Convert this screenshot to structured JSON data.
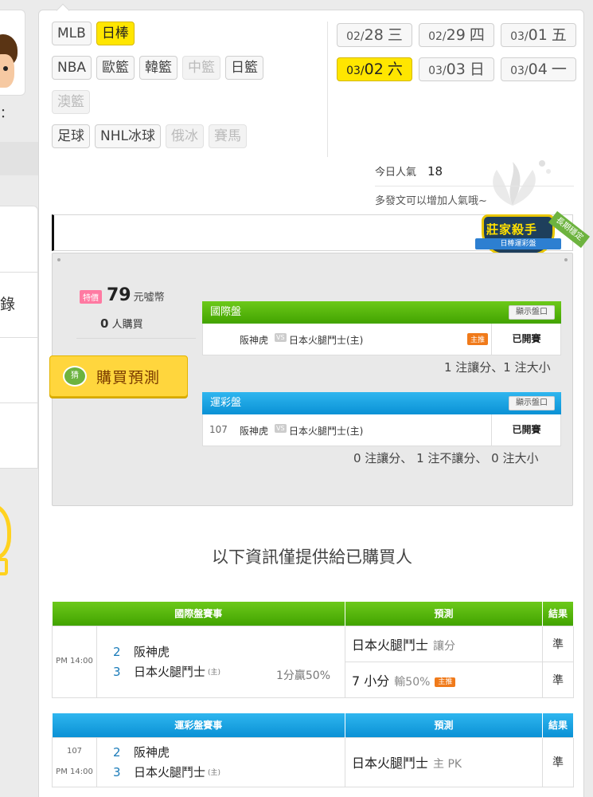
{
  "sidebar": {
    "partial_char": "：",
    "partial_label": "錄"
  },
  "leagues": {
    "rows": [
      [
        {
          "label": "MLB",
          "state": "normal"
        },
        {
          "label": "日棒",
          "state": "active"
        }
      ],
      [
        {
          "label": "NBA",
          "state": "normal"
        },
        {
          "label": "歐籃",
          "state": "normal"
        },
        {
          "label": "韓籃",
          "state": "normal"
        },
        {
          "label": "中籃",
          "state": "disabled"
        },
        {
          "label": "日籃",
          "state": "normal"
        }
      ],
      [
        {
          "label": "澳籃",
          "state": "disabled"
        }
      ],
      [
        {
          "label": "足球",
          "state": "normal"
        },
        {
          "label": "NHL冰球",
          "state": "normal"
        },
        {
          "label": "俄冰",
          "state": "disabled"
        },
        {
          "label": "賽馬",
          "state": "disabled"
        }
      ]
    ]
  },
  "dates": [
    {
      "month": "02/",
      "day": "28",
      "weekday": "三",
      "active": false
    },
    {
      "month": "02/",
      "day": "29",
      "weekday": "四",
      "active": false
    },
    {
      "month": "03/",
      "day": "01",
      "weekday": "五",
      "active": false
    },
    {
      "month": "03/",
      "day": "02",
      "weekday": "六",
      "active": true
    },
    {
      "month": "03/",
      "day": "03",
      "weekday": "日",
      "active": false
    },
    {
      "month": "03/",
      "day": "04",
      "weekday": "一",
      "active": false
    }
  ],
  "popularity": {
    "label": "今日人氣",
    "value": "18",
    "hint": "多發文可以增加人氣哦~"
  },
  "badge": {
    "title": "莊家殺手",
    "ribbon": "日棒運彩盤",
    "strip": "長期穩定"
  },
  "purchase": {
    "special_tag": "特價",
    "price": "79",
    "unit": "元噓幣",
    "buyers_count": "0",
    "buyers_suffix": "人購買",
    "buy_button": "購買預測",
    "buy_icon": "猜"
  },
  "international_line": {
    "title": "國際盤",
    "show_button": "顯示盤口",
    "number": "",
    "away": "阪神虎",
    "vs": "VS",
    "home": "日本火腿鬥士(主)",
    "host_tag": "主推",
    "status": "已開賽",
    "summary": "1 注讓分、1 注大小"
  },
  "sports_lottery_line": {
    "title": "運彩盤",
    "show_button": "顯示盤口",
    "number": "107",
    "away": "阪神虎",
    "vs": "VS",
    "home": "日本火腿鬥士(主)",
    "status": "已開賽",
    "summary": "0 注讓分、 1 注不讓分、 0 注大小"
  },
  "notice": "以下資訊僅提供給已購買人",
  "intl_table": {
    "headers": [
      "國際盤賽事",
      "預測",
      "結果"
    ],
    "time": "PM 14:00",
    "team1_num": "2",
    "team1": "阪神虎",
    "team2_num": "3",
    "team2": "日本火腿鬥士",
    "host": "(主)",
    "odds": "1分贏50%",
    "pred1_name": "日本火腿鬥士",
    "pred1_type": "讓分",
    "result1": "準",
    "pred2_name": "7 小分",
    "pred2_type": "輸50%",
    "pred2_tag": "主推",
    "result2": "準"
  },
  "lottery_table": {
    "headers": [
      "運彩盤賽事",
      "預測",
      "結果"
    ],
    "number": "107",
    "time": "PM 14:00",
    "team1_num": "2",
    "team1": "阪神虎",
    "team2_num": "3",
    "team2": "日本火腿鬥士",
    "host": "(主)",
    "pred_name": "日本火腿鬥士",
    "pred_type": "主 PK",
    "result": "準"
  },
  "colors": {
    "accent_yellow": "#ffe600",
    "header_green": "#42a300",
    "header_blue": "#0a91d5",
    "result_green": "#2c9a1d",
    "host_orange": "#f07a1a"
  }
}
